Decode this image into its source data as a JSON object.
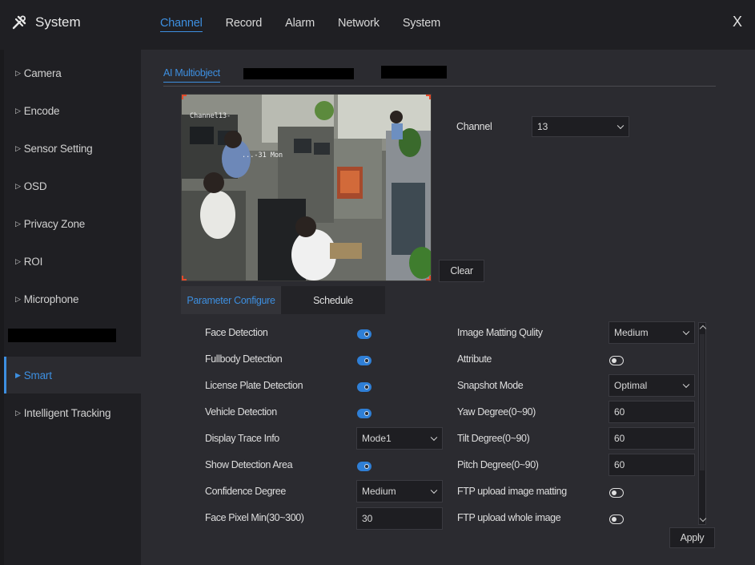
{
  "app": {
    "title": "System",
    "icon": "tools-icon"
  },
  "top_tabs": [
    "Channel",
    "Record",
    "Alarm",
    "Network",
    "System"
  ],
  "active_top_tab": "Channel",
  "close_label": "X",
  "sidebar": {
    "items": [
      {
        "label": "Camera"
      },
      {
        "label": "Encode"
      },
      {
        "label": "Sensor Setting"
      },
      {
        "label": "OSD"
      },
      {
        "label": "Privacy Zone"
      },
      {
        "label": "ROI"
      },
      {
        "label": "Microphone"
      },
      {
        "label": "Smart"
      },
      {
        "label": "Intelligent Tracking"
      }
    ],
    "active": "Smart"
  },
  "subtabs": {
    "active": "AI Multiobject"
  },
  "video": {
    "osd_channel": "Channel13-",
    "osd_date": "...-31 Mon"
  },
  "channel": {
    "label": "Channel",
    "value": "13"
  },
  "clear_label": "Clear",
  "param_tabs": {
    "active": "Parameter Configure",
    "other": "Schedule"
  },
  "left_params": {
    "face_detection": {
      "label": "Face Detection",
      "on": true
    },
    "fullbody_detection": {
      "label": "Fullbody Detection",
      "on": true
    },
    "license_plate": {
      "label": "License Plate Detection",
      "on": true
    },
    "vehicle_detection": {
      "label": "Vehicle Detection",
      "on": true
    },
    "display_trace": {
      "label": "Display Trace Info",
      "value": "Mode1"
    },
    "show_area": {
      "label": "Show Detection Area",
      "on": true
    },
    "confidence": {
      "label": "Confidence Degree",
      "value": "Medium"
    },
    "face_pixel": {
      "label": "Face Pixel Min(30~300)",
      "value": "30"
    }
  },
  "right_params": {
    "matting_quality": {
      "label": "Image Matting Qulity",
      "value": "Medium"
    },
    "attribute": {
      "label": "Attribute",
      "on": false
    },
    "snapshot_mode": {
      "label": "Snapshot Mode",
      "value": "Optimal"
    },
    "yaw": {
      "label": "Yaw Degree(0~90)",
      "value": "60"
    },
    "tilt": {
      "label": "Tilt Degree(0~90)",
      "value": "60"
    },
    "pitch": {
      "label": "Pitch Degree(0~90)",
      "value": "60"
    },
    "ftp_matting": {
      "label": "FTP upload image matting",
      "on": false
    },
    "ftp_whole": {
      "label": "FTP upload whole image",
      "on": false
    }
  },
  "apply_label": "Apply",
  "colors": {
    "accent": "#3d8fe0",
    "toggle_on": "#2f7fd6",
    "video_border": "#e34a2a"
  }
}
